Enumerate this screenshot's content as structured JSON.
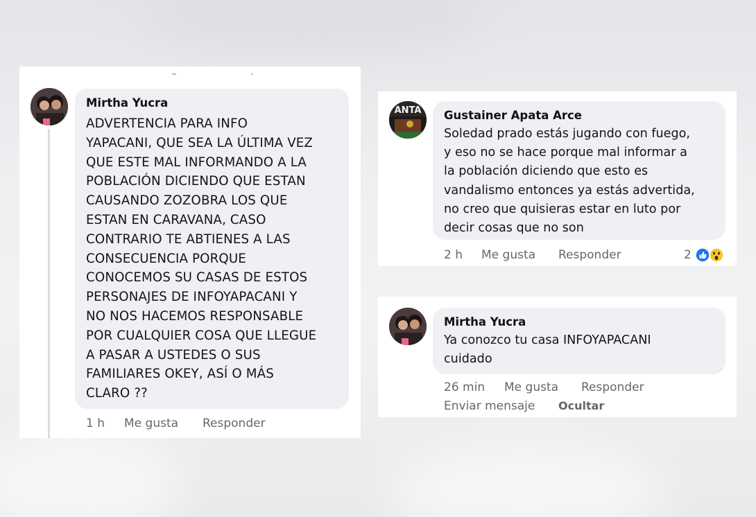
{
  "comment1": {
    "author": "Mirtha Yucra",
    "text": "ADVERTENCIA PARA INFO\nYAPACANI, QUE SEA LA ÚLTIMA VEZ\nQUE ESTE MAL INFORMANDO A LA\nPOBLACIÓN DICIENDO QUE ESTAN\nCAUSANDO ZOZOBRA LOS QUE\nESTAN EN CARAVANA, CASO\nCONTRARIO TE ABTIENES A LAS\nCONSECUENCIA PORQUE\nCONOCEMOS SU CASAS DE ESTOS\nPERSONAJES DE INFOYAPACANI Y\nNO NOS HACEMOS RESPONSABLE\nPOR CUALQUIER COSA QUE LLEGUE\nA PASAR A USTEDES O SUS\nFAMILIARES OKEY, ASÍ O MÁS\nCLARO ??",
    "time": "1 h",
    "like_label": "Me gusta",
    "reply_label": "Responder"
  },
  "comment2": {
    "author": "Gustainer Apata Arce",
    "text": "Soledad prado estás jugando con fuego,\ny eso no se hace porque mal informar a\nla población diciendo que esto es\nvandalismo entonces ya estás advertida,\nno creo que quisieras estar en luto por\ndecir cosas que no son",
    "time": "2 h",
    "like_label": "Me gusta",
    "reply_label": "Responder",
    "reaction_count": "2",
    "avatar_text": "ANTA"
  },
  "comment3": {
    "author": "Mirtha Yucra",
    "text": "Ya conozco tu casa INFOYAPACANI\ncuidado",
    "time": "26 min",
    "like_label": "Me gusta",
    "reply_label": "Responder",
    "message_label": "Enviar mensaje",
    "hide_label": "Ocultar"
  },
  "colors": {
    "bubble": "#eff0f3",
    "meta_text": "#646769",
    "like_blue": "#1877f2",
    "wow_yellow": "#f7c52b"
  },
  "icons": [
    "avatar-photo",
    "like-reaction-icon",
    "wow-reaction-icon"
  ]
}
